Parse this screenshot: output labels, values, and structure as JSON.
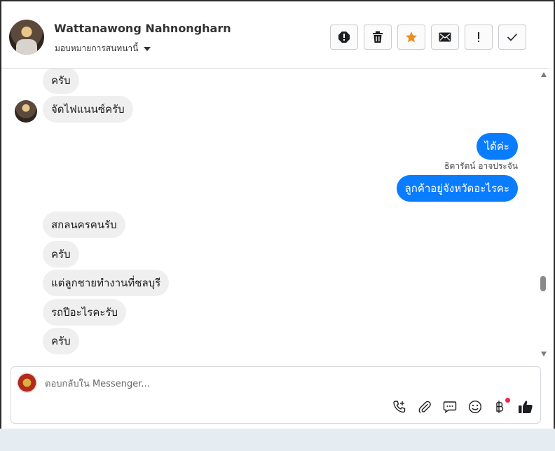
{
  "header": {
    "contact_name": "Wattanawong Nahnongharn",
    "assign_label": "มอบหมายการสนทนานี้",
    "toolbar": [
      {
        "name": "mark-spam-button",
        "icon": "alert-octagon-icon"
      },
      {
        "name": "delete-button",
        "icon": "trash-icon"
      },
      {
        "name": "star-button",
        "icon": "star-icon"
      },
      {
        "name": "mark-unread-button",
        "icon": "envelope-icon"
      },
      {
        "name": "follow-up-button",
        "icon": "exclamation-icon"
      },
      {
        "name": "mark-done-button",
        "icon": "check-icon"
      }
    ]
  },
  "thread": {
    "messages": [
      {
        "side": "in",
        "text": "ครับ"
      },
      {
        "side": "in",
        "text": "จัดไฟแนนซ์ครับ"
      },
      {
        "side": "out",
        "text": "ได้ค่ะ"
      },
      {
        "side": "meta",
        "text": "ธิดารัตน์ อาจประจัน"
      },
      {
        "side": "out",
        "text": "ลูกค้าอยู่จังหวัดอะไรคะ"
      },
      {
        "side": "in",
        "text": "สกลนครคนรับ"
      },
      {
        "side": "in",
        "text": "ครับ"
      },
      {
        "side": "in",
        "text": "แต่ลูกชายทำงานที่ชลบุรี"
      },
      {
        "side": "in",
        "text": "รถปีอะไรคะรับ"
      },
      {
        "side": "in",
        "text": "ครับ"
      }
    ]
  },
  "composer": {
    "placeholder": "ตอบกลับใน Messenger...",
    "tools": [
      "call-add-icon",
      "paperclip-icon",
      "chat-bubble-icon",
      "emoji-icon",
      "baht-icon",
      "thumbs-up-icon"
    ]
  },
  "colors": {
    "outgoing_bubble": "#0a7cff",
    "incoming_bubble": "#efefef",
    "star": "#f08c1a",
    "thumbs_up": "#1c1e21"
  }
}
